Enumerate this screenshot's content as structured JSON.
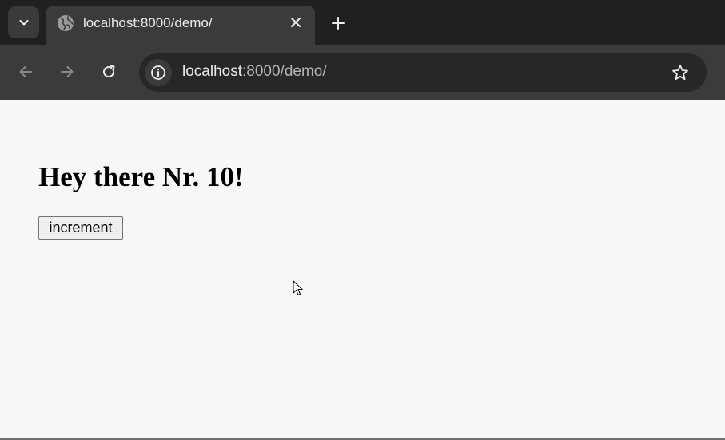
{
  "browser": {
    "tab": {
      "title": "localhost:8000/demo/",
      "favicon": "globe-icon"
    },
    "address_bar": {
      "host": "localhost",
      "path": ":8000/demo/"
    },
    "icons": {
      "tab_search": "chevron-down-icon",
      "tab_close": "close-icon",
      "new_tab": "plus-icon",
      "back": "arrow-left-icon",
      "forward": "arrow-right-icon",
      "reload": "reload-icon",
      "site_info": "info-icon",
      "bookmark": "star-icon"
    },
    "colors": {
      "tabstrip_bg": "#202020",
      "toolbar_bg": "#3b3b3b",
      "omnibox_bg": "#272727",
      "page_bg": "#f8f8f8"
    }
  },
  "page": {
    "heading": "Hey there Nr. 10!",
    "increment_label": "increment"
  }
}
